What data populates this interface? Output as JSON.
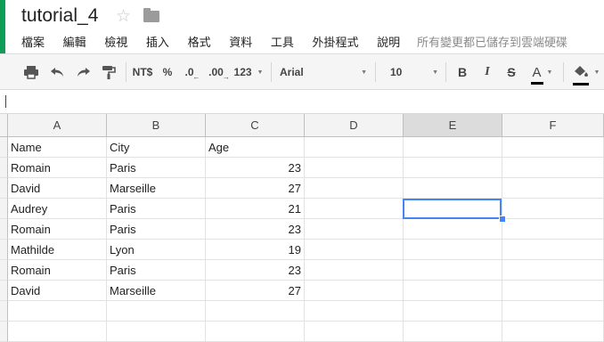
{
  "doc": {
    "title": "tutorial_4",
    "save_status": "所有變更都已儲存到雲端硬碟"
  },
  "menu": [
    "檔案",
    "編輯",
    "檢視",
    "插入",
    "格式",
    "資料",
    "工具",
    "外掛程式",
    "說明"
  ],
  "toolbar": {
    "currency": "NT$",
    "percent": "%",
    "dec_decrease": ".0",
    "dec_increase": ".00",
    "more_formats": "123",
    "font": "Arial",
    "font_size": "10",
    "bold": "B",
    "italic": "I",
    "strike": "S",
    "text_color_glyph": "A",
    "text_color": "#000000",
    "fill_color": "#000000"
  },
  "grid": {
    "columns": [
      "A",
      "B",
      "C",
      "D",
      "E",
      "F"
    ],
    "selected_column": "E",
    "rows": [
      [
        "Name",
        "City",
        "Age"
      ],
      [
        "Romain",
        "Paris",
        "23"
      ],
      [
        "David",
        "Marseille",
        "27"
      ],
      [
        "Audrey",
        "Paris",
        "21"
      ],
      [
        "Romain",
        "Paris",
        "23"
      ],
      [
        "Mathilde",
        "Lyon",
        "19"
      ],
      [
        "Romain",
        "Paris",
        "23"
      ],
      [
        "David",
        "Marseille",
        "27"
      ],
      [
        "",
        "",
        ""
      ],
      [
        "",
        "",
        ""
      ]
    ],
    "selection_color": "#4285f4"
  }
}
